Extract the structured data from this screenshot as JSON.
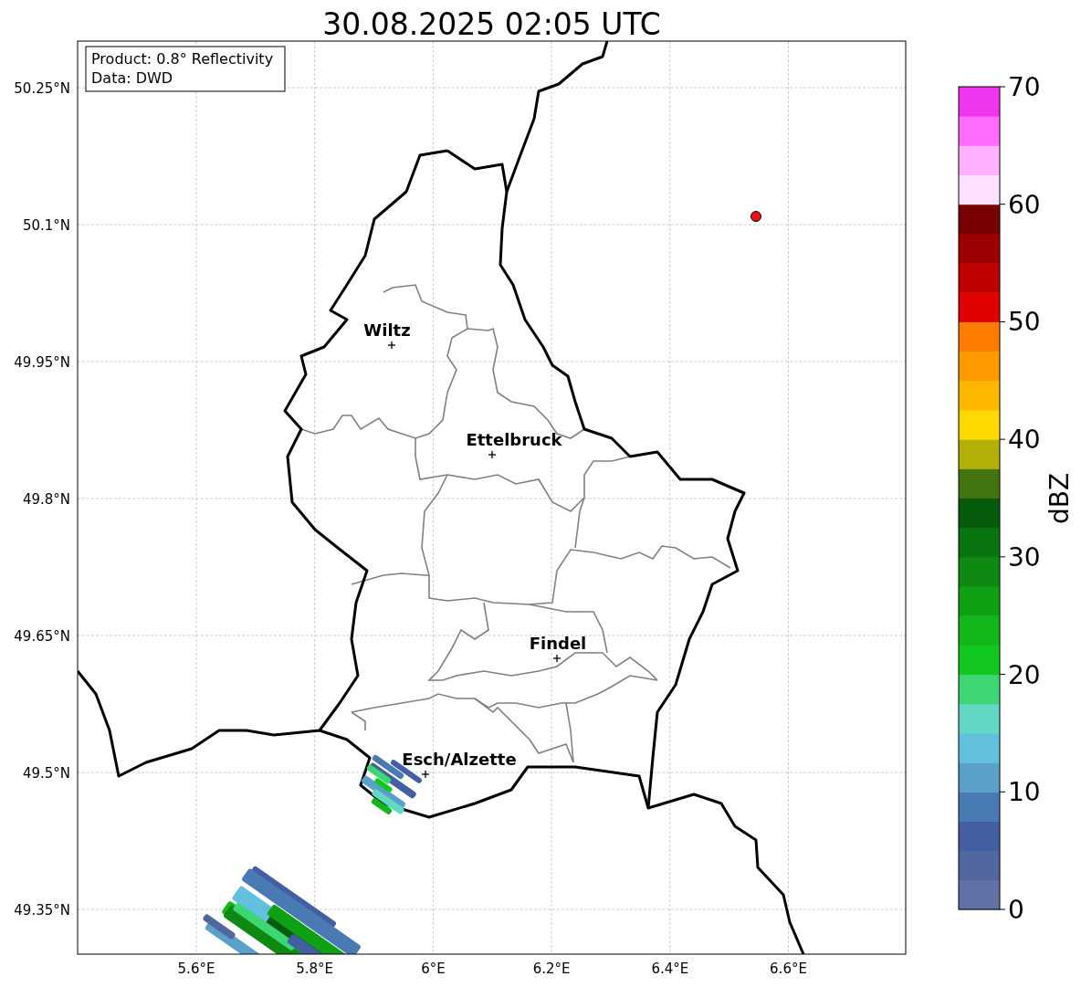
{
  "title": "30.08.2025 02:05 UTC",
  "info_box": [
    "Product: 0.8° Reflectivity",
    "Data: DWD"
  ],
  "y_ticks": [
    "50.25°N",
    "50.1°N",
    "49.95°N",
    "49.8°N",
    "49.65°N",
    "49.5°N",
    "49.35°N"
  ],
  "x_ticks": [
    "5.6°E",
    "5.8°E",
    "6°E",
    "6.2°E",
    "6.4°E",
    "6.6°E"
  ],
  "cities": [
    {
      "name": "Wiltz"
    },
    {
      "name": "Ettelbruck"
    },
    {
      "name": "Findel"
    },
    {
      "name": "Esch/Alzette"
    }
  ],
  "colorbar": {
    "label": "dBZ",
    "ticks": [
      "70",
      "60",
      "50",
      "40",
      "30",
      "20",
      "10",
      "0"
    ],
    "segments": [
      {
        "color": "#6272a6"
      },
      {
        "color": "#5266a0"
      },
      {
        "color": "#445ea4"
      },
      {
        "color": "#4a7ab4"
      },
      {
        "color": "#5aa0c8"
      },
      {
        "color": "#62c0dc"
      },
      {
        "color": "#62d8c4"
      },
      {
        "color": "#3ed674"
      },
      {
        "color": "#12c820"
      },
      {
        "color": "#12b81a"
      },
      {
        "color": "#10a014"
      },
      {
        "color": "#0e8a12"
      },
      {
        "color": "#0a7410"
      },
      {
        "color": "#065c0c"
      },
      {
        "color": "#447410"
      },
      {
        "color": "#b0b008"
      },
      {
        "color": "#ffd800"
      },
      {
        "color": "#ffb800"
      },
      {
        "color": "#ff9a00"
      },
      {
        "color": "#ff7c00"
      },
      {
        "color": "#e00000"
      },
      {
        "color": "#c00000"
      },
      {
        "color": "#9c0000"
      },
      {
        "color": "#780000"
      },
      {
        "color": "#ffe0ff"
      },
      {
        "color": "#ffb0ff"
      },
      {
        "color": "#ff6cff"
      },
      {
        "color": "#ee36ee"
      }
    ]
  }
}
